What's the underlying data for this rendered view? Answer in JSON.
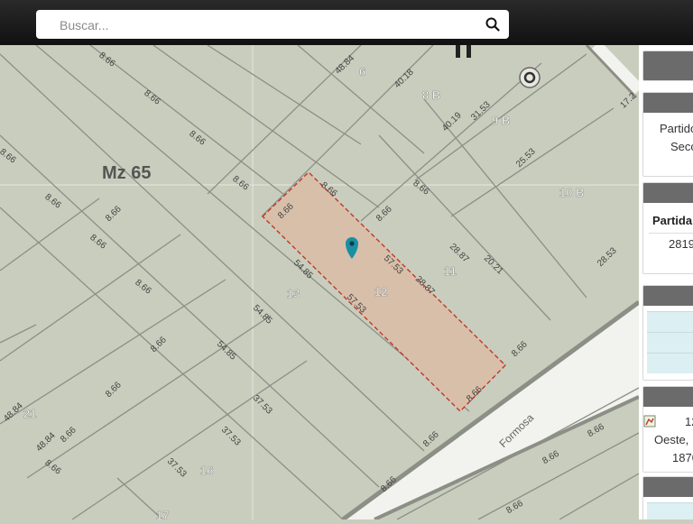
{
  "search": {
    "placeholder": "Buscar..."
  },
  "map": {
    "block_label": "Mz 65",
    "street_name": "Formosa",
    "selected_parcel": "12",
    "parcel_labels": [
      "6",
      "8 B",
      "9 B",
      "10 B",
      "11",
      "12",
      "13",
      "16",
      "17",
      "21"
    ],
    "dimensions": [
      "8.66",
      "48.84",
      "40.18",
      "40.19",
      "31.53",
      "25.53",
      "17.2",
      "8.66",
      "8.66",
      "28.87",
      "20.21",
      "28.53",
      "57.53",
      "28.87",
      "54.85",
      "57.53",
      "54.85",
      "54.85",
      "37.53",
      "37.53",
      "37.53",
      "48.84",
      "48.84"
    ],
    "marker_icon": "location-pin-icon",
    "compass_icon": "north-arrow-icon"
  },
  "panel": {
    "card2": {
      "line1": "Partido",
      "line2": "Secc"
    },
    "card3": {
      "header": "Partida",
      "value": "2819"
    },
    "card5": {
      "line1": "12",
      "line2": "Oeste,",
      "line3": "1870"
    }
  },
  "colors": {
    "parcel_fill": "#d8bfa9",
    "parcel_border": "#c0392b",
    "marker": "#1a8fa3",
    "map_bg": "#c9cdbd",
    "street": "#f2f2ee"
  }
}
